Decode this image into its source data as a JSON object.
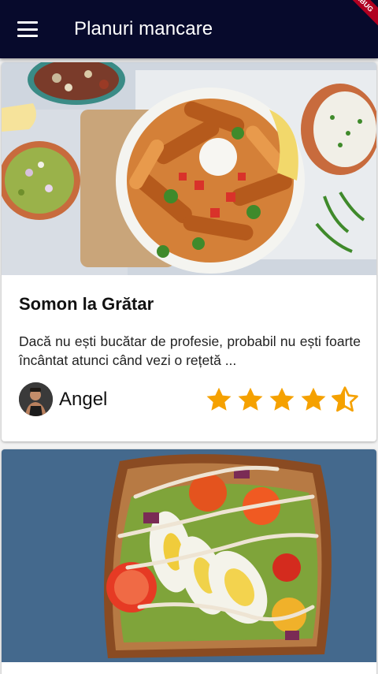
{
  "appbar": {
    "title": "Planuri mancare",
    "menu_icon": "hamburger-menu-icon",
    "debug_banner": "DEBUG"
  },
  "recipes": [
    {
      "title": "Somon la Grătar",
      "description": "Dacă nu ești bucătar de profesie, probabil nu ești foarte încântat atunci când vezi o rețetă ...",
      "author": "Angel",
      "rating": 4.5,
      "rating_max": 5,
      "image": "sweet-potato-fries-bowl-photo"
    },
    {
      "image": "avocado-egg-toast-photo"
    }
  ],
  "colors": {
    "appbar": "#070a2c",
    "star": "#f5a100",
    "background": "#f2f2f2"
  }
}
